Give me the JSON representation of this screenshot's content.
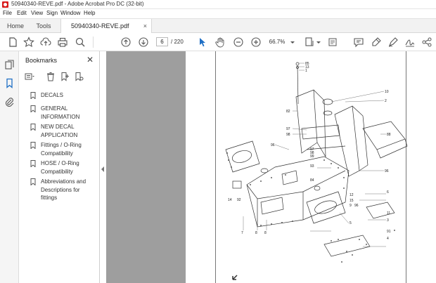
{
  "window": {
    "title": "50940340-REVE.pdf - Adobe Acrobat Pro DC (32-bit)"
  },
  "menubar": {
    "items": [
      "File",
      "Edit",
      "View",
      "Sign",
      "Window",
      "Help"
    ]
  },
  "tabs": {
    "home": "Home",
    "tools": "Tools",
    "document": "50940340-REVE.pdf",
    "close_symbol": "×"
  },
  "toolbar": {
    "current_page": "6",
    "page_total": "/  220",
    "zoom": "66.7%",
    "icons": [
      "star-icon",
      "upload-icon",
      "print-icon",
      "search-icon",
      "prev-page-icon",
      "next-page-icon",
      "select-arrow-icon",
      "hand-icon",
      "zoom-out-icon",
      "zoom-in-icon",
      "page-fit-icon",
      "comment-icon",
      "highlight-icon",
      "draw-icon",
      "sign-icon"
    ]
  },
  "bookmarks": {
    "title": "Bookmarks",
    "close_symbol": "✕",
    "items": [
      {
        "label": "DECALS"
      },
      {
        "label": "GENERAL INFORMATION"
      },
      {
        "label": "NEW DECAL APPLICATION"
      },
      {
        "label": "Fittings / O-Ring Compatibility"
      },
      {
        "label": "HOSE / O-Ring Compatibility"
      },
      {
        "label": "Abbreviations and Descriptions for fittings"
      }
    ]
  },
  "drawing": {
    "callouts": [
      "85",
      "13",
      "1",
      "10",
      "2",
      "82",
      "97",
      "98",
      "88",
      "96",
      "97",
      "98",
      "99",
      "96",
      "93",
      "84",
      "14",
      "92",
      "6",
      "12",
      "15",
      "9",
      "96",
      "11",
      "3",
      "5",
      "7",
      "8",
      "8",
      "91",
      "4"
    ]
  },
  "colors": {
    "acrobat_red": "#d81e1e",
    "accent_blue": "#1f6fc5",
    "viewer_gray": "#9e9e9e"
  }
}
